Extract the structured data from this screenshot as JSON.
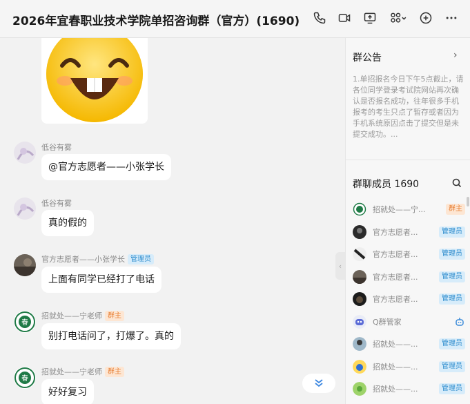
{
  "header": {
    "title": "2026年宜春职业技术学院单招咨询群（官方）(1690)"
  },
  "messages": [
    {
      "sender": "低谷有雾",
      "badge": "",
      "text": "@官方志愿者——小张学长"
    },
    {
      "sender": "低谷有雾",
      "badge": "",
      "text": "真的假的"
    },
    {
      "sender": "官方志愿者——小张学长",
      "badge": "管理员",
      "text": "上面有同学已经打了电话"
    },
    {
      "sender": "招就处——宁老师",
      "badge": "群主",
      "text": "别打电话问了，打爆了。真的"
    },
    {
      "sender": "招就处——宁老师",
      "badge": "群主",
      "text": "好好复习"
    }
  ],
  "sidebar": {
    "notice_title": "群公告",
    "notice_text": "1.单招报名今日下午5点截止，请各位同学登录考试院网站再次确认是否报名成功，往年很多手机报考的考生只点了暂存或者因为手机系统原因点击了提交但是未提交成功。...",
    "members_title": "群聊成员 1690",
    "members": [
      {
        "name": "招就处——宁...",
        "badge": "群主"
      },
      {
        "name": "官方志愿者...",
        "badge": "管理员"
      },
      {
        "name": "官方志愿者...",
        "badge": "管理员"
      },
      {
        "name": "官方志愿者...",
        "badge": "管理员"
      },
      {
        "name": "官方志愿者...",
        "badge": "管理员"
      },
      {
        "name": "Q群管家",
        "badge": ""
      },
      {
        "name": "招就处——...",
        "badge": "管理员"
      },
      {
        "name": "招就处——...",
        "badge": "管理员"
      },
      {
        "name": "招就处——...",
        "badge": "管理员"
      }
    ]
  },
  "colors": {
    "owner_badge": "#e8833a",
    "admin_badge": "#2d8ccd",
    "bot_icon": "#3b8bd9"
  }
}
